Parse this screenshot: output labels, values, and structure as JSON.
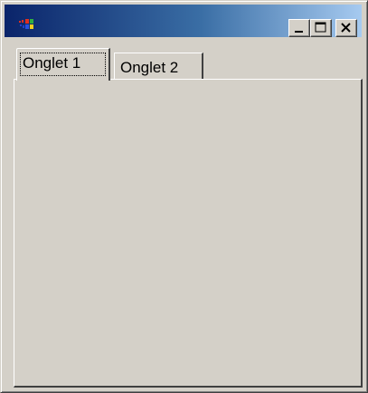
{
  "window": {
    "title": "",
    "icon": "windows-flag-icon",
    "titlebar_colors": [
      "#0a246a",
      "#a6caf0"
    ],
    "face_color": "#d4d0c8"
  },
  "controls": {
    "minimize_icon": "minimize-icon",
    "maximize_icon": "maximize-icon",
    "close_icon": "close-icon"
  },
  "tabs": [
    {
      "label": "Onglet 1",
      "selected": true
    },
    {
      "label": "Onglet 2",
      "selected": false
    }
  ]
}
